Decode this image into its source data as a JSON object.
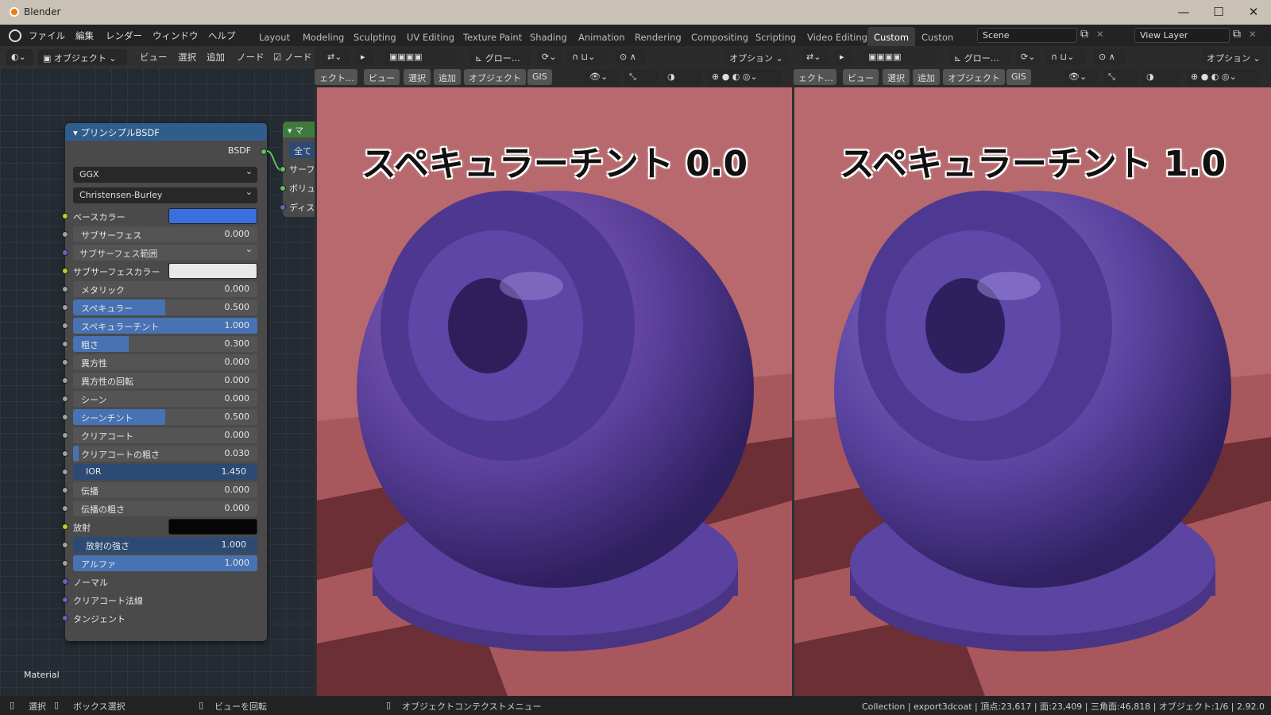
{
  "window": {
    "title": "Blender",
    "minimize": "—",
    "maximize": "☐",
    "close": "✕"
  },
  "menus": [
    "ファイル",
    "編集",
    "レンダー",
    "ウィンドウ",
    "ヘルプ"
  ],
  "workspaces": [
    "Layout",
    "Modeling",
    "Sculpting",
    "UV Editing",
    "Texture Paint",
    "Shading",
    "Animation",
    "Rendering",
    "Compositing",
    "Scripting",
    "Video Editing",
    "Custom",
    "Custon"
  ],
  "active_workspace": "Custom",
  "scene": "Scene",
  "view_layer": "View Layer",
  "node_header": {
    "mode": "オブジェクト",
    "items": [
      "ビュー",
      "選択",
      "追加",
      "ノード"
    ],
    "checkbox_label": "ノード"
  },
  "vp_header": {
    "orientation": "グロー…",
    "options": "オプション",
    "mode": "ェクト…",
    "items": [
      "ビュー",
      "選択",
      "追加",
      "オブジェクト",
      "GIS"
    ]
  },
  "node": {
    "title": "プリンシプルBSDF",
    "output": "BSDF",
    "distribution": "GGX",
    "subsurface_method": "Christensen-Burley",
    "base_color_label": "ベースカラー",
    "base_color": "#3a6fe0",
    "subsurface_label": "サブサーフェス",
    "subsurface": "0.000",
    "subsurface_radius": "サブサーフェス範囲",
    "subsurface_color_label": "サブサーフェスカラー",
    "subsurface_color": "#e8e8e8",
    "metallic_label": "メタリック",
    "metallic": "0.000",
    "specular_label": "スペキュラー",
    "specular": "0.500",
    "specular_tint_label": "スペキュラーチント",
    "specular_tint": "1.000",
    "roughness_label": "粗さ",
    "roughness": "0.300",
    "anisotropic_label": "異方性",
    "anisotropic": "0.000",
    "aniso_rot_label": "異方性の回転",
    "aniso_rot": "0.000",
    "sheen_label": "シーン",
    "sheen": "0.000",
    "sheen_tint_label": "シーンチント",
    "sheen_tint": "0.500",
    "clearcoat_label": "クリアコート",
    "clearcoat": "0.000",
    "clearcoat_rough_label": "クリアコートの粗さ",
    "clearcoat_rough": "0.030",
    "ior_label": "IOR",
    "ior": "1.450",
    "transmission_label": "伝播",
    "transmission": "0.000",
    "trans_rough_label": "伝播の粗さ",
    "trans_rough": "0.000",
    "emission_label": "放射",
    "emission_color": "#050505",
    "emission_strength_label": "放射の強さ",
    "emission_strength": "1.000",
    "alpha_label": "アルファ",
    "alpha": "1.000",
    "normal_label": "ノーマル",
    "clearcoat_normal_label": "クリアコート法線",
    "tangent_label": "タンジェント"
  },
  "output_node": {
    "title": "マ",
    "btn": "全て",
    "inputs": [
      "サーフ",
      "ボリュ",
      "ディス"
    ]
  },
  "material_label": "Material",
  "viewport_left": {
    "title": "スペキュラーチント 0.0"
  },
  "viewport_right": {
    "title": "スペキュラーチント 1.0"
  },
  "status": {
    "select": "選択",
    "box_select": "ボックス選択",
    "rotate": "ビューを回転",
    "context": "オブジェクトコンテクストメニュー",
    "stats": "Collection | export3dcoat | 頂点:23,617 | 面:23,409 | 三角面:46,818 | オブジェクト:1/6 | 2.92.0"
  }
}
